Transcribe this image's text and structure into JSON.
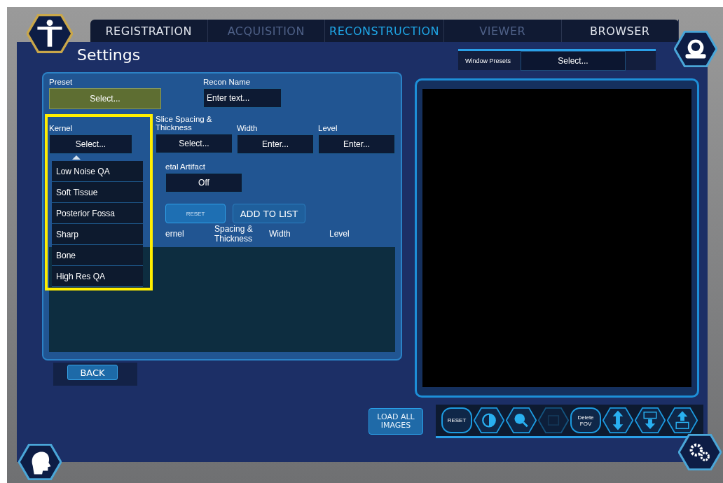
{
  "tabs": [
    {
      "label": "REGISTRATION",
      "selected": false,
      "disabled": false
    },
    {
      "label": "ACQUISITION",
      "selected": false,
      "disabled": true
    },
    {
      "label": "RECONSTRUCTION",
      "selected": true,
      "disabled": false
    },
    {
      "label": "VIEWER",
      "selected": false,
      "disabled": true
    },
    {
      "label": "BROWSER",
      "selected": false,
      "disabled": false
    }
  ],
  "title": "Settings",
  "window_presets": {
    "label": "Window Presets",
    "value": "Select..."
  },
  "form": {
    "preset": {
      "label": "Preset",
      "value": "Select..."
    },
    "recon_name": {
      "label": "Recon Name",
      "placeholder": "Enter text..."
    },
    "kernel": {
      "label": "Kernel",
      "value": "Select...",
      "expanded": true,
      "highlighted": true,
      "options": [
        "Low Noise QA",
        "Soft Tissue",
        "Posterior Fossa",
        "Sharp",
        "Bone",
        "High Res QA"
      ]
    },
    "slice_spacing": {
      "label": "Slice Spacing & Thickness",
      "value": "Select..."
    },
    "width": {
      "label": "Width",
      "placeholder": "Enter..."
    },
    "level": {
      "label": "Level",
      "placeholder": "Enter..."
    },
    "metal_artifact": {
      "label": "etal Artifact",
      "value": "Off"
    },
    "reset_button": "RESET",
    "add_button": "ADD TO LIST",
    "list_columns": [
      "ernel",
      "Spacing & Thickness",
      "Width",
      "Level"
    ]
  },
  "back_button": "BACK",
  "load_all_button": "LOAD ALL IMAGES",
  "toolbar": [
    {
      "kind": "text",
      "label": "RESET",
      "disabled": false
    },
    {
      "kind": "contrast",
      "disabled": false
    },
    {
      "kind": "zoom",
      "disabled": false
    },
    {
      "kind": "square",
      "disabled": true
    },
    {
      "kind": "text",
      "label": "Delete FOV",
      "disabled": false
    },
    {
      "kind": "arrows_vertical",
      "disabled": false
    },
    {
      "kind": "arrow_down_box",
      "disabled": false
    },
    {
      "kind": "arrow_up_box",
      "disabled": false
    }
  ]
}
